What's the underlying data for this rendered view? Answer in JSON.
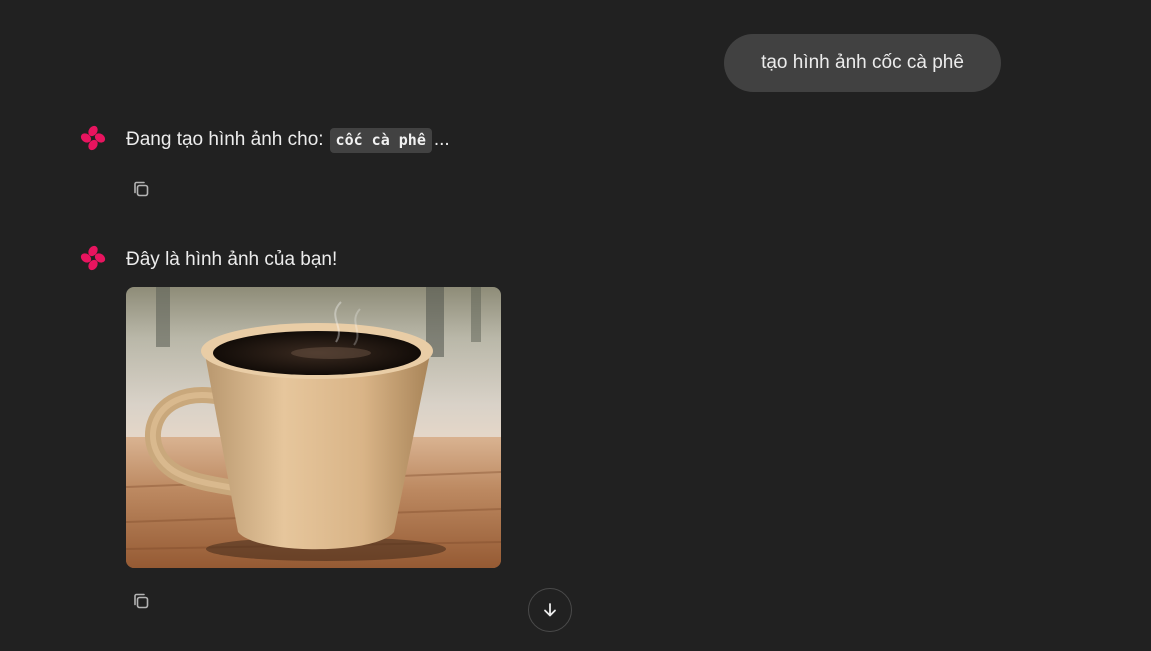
{
  "user_message": {
    "text": "tạo hình ảnh cốc cà phê"
  },
  "assistant_messages": [
    {
      "prefix": "Đang tạo hình ảnh cho:",
      "code": "cốc cà phê",
      "suffix": "..."
    },
    {
      "text": "Đây là hình ảnh của bạn!",
      "image_subject": "cup of coffee on wooden table"
    }
  ],
  "icons": {
    "assistant_avatar": "pink-four-petal-icon",
    "copy": "copy-icon",
    "scroll_down": "arrow-down-icon"
  },
  "colors": {
    "background": "#212121",
    "user_bubble": "#414141",
    "accent_pink": "#e8145f",
    "text": "#ececec"
  }
}
